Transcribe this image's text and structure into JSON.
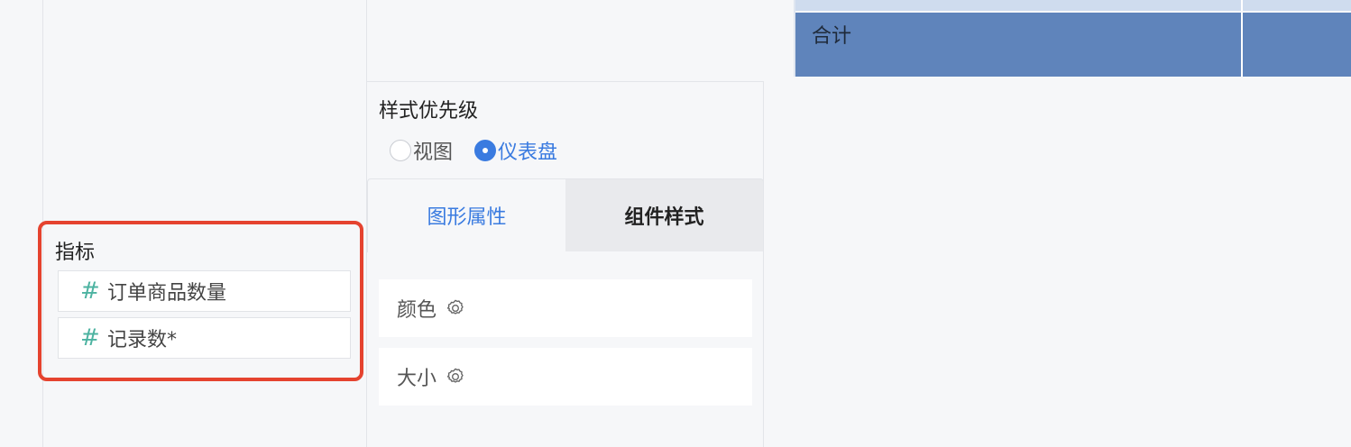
{
  "metrics": {
    "title": "指标",
    "items": [
      {
        "hash": "#",
        "label": "订单商品数量"
      },
      {
        "hash": "#",
        "label": "记录数*"
      }
    ]
  },
  "style_priority": {
    "title": "样式优先级",
    "options": [
      {
        "label": "视图",
        "selected": false
      },
      {
        "label": "仪表盘",
        "selected": true
      }
    ]
  },
  "tabs": [
    {
      "label": "图形属性",
      "active": true
    },
    {
      "label": "组件样式",
      "active": false
    }
  ],
  "properties": [
    {
      "label": "颜色",
      "icon": "gear-icon"
    },
    {
      "label": "大小",
      "icon": "gear-icon"
    }
  ],
  "table": {
    "total_label": "合计"
  },
  "colors": {
    "accent": "#3a7be0",
    "highlight_border": "#e5432f",
    "metric_hash": "#4db3a1",
    "table_header": "#5f84bb"
  }
}
